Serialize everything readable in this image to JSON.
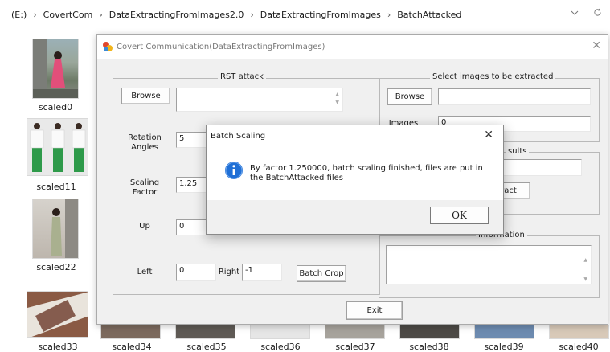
{
  "breadcrumb": {
    "items": [
      "(E:)",
      "CovertCom",
      "DataExtractingFromImages2.0",
      "DataExtractingFromImages",
      "BatchAttacked"
    ],
    "separator": "›"
  },
  "addressbar_icons": [
    "chevron-down-icon",
    "refresh-icon"
  ],
  "thumbnails": [
    {
      "label": "scaled0"
    },
    {
      "label": "scaled11"
    },
    {
      "label": "scaled22"
    },
    {
      "label": "scaled33"
    },
    {
      "label": "scaled34"
    },
    {
      "label": "scaled35"
    },
    {
      "label": "scaled36"
    },
    {
      "label": "scaled37"
    },
    {
      "label": "scaled38"
    },
    {
      "label": "scaled39"
    },
    {
      "label": "scaled40"
    }
  ],
  "app": {
    "title": "Covert Communication(DataExtractingFromImages)",
    "rst": {
      "title": "RST attack",
      "browse": "Browse",
      "rotation_label": "Rotation Angles",
      "rotation_value": "5",
      "scaling_label": "Scaling Factor",
      "scaling_value": "1.25",
      "up_label": "Up",
      "up_value": "0",
      "left_label": "Left",
      "left_value": "0",
      "right_label": "Right",
      "right_value": "-1",
      "batch_crop": "Batch Crop"
    },
    "select": {
      "title": "Select images to be extracted",
      "browse": "Browse",
      "images_label": "Images",
      "images_value": "0"
    },
    "results": {
      "title_fragment": "sults",
      "extract_fragment": "ract"
    },
    "info": {
      "title": "Information"
    },
    "exit": "Exit"
  },
  "dialog": {
    "title": "Batch Scaling",
    "message": "By factor 1.250000, batch scaling finished, files are put in the BatchAttacked files",
    "ok": "OK"
  },
  "colors": {
    "info_icon": "#1f6fd6",
    "window_bg": "#f0f0f0"
  }
}
